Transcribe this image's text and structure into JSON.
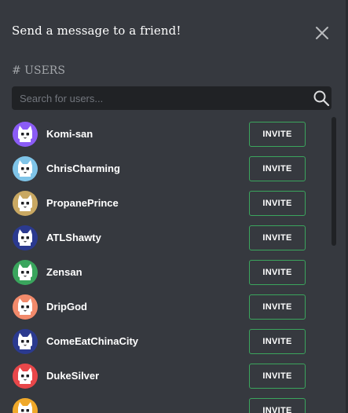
{
  "modal": {
    "title": "Send a message to a friend!",
    "section_label": "# USERS"
  },
  "search": {
    "placeholder": "Search for users...",
    "value": ""
  },
  "users": [
    {
      "name": "Komi-san",
      "avatar_color": "#8b5cf6",
      "invite_label": "INVITE"
    },
    {
      "name": "ChrisCharming",
      "avatar_color": "#7fc4e8",
      "invite_label": "INVITE"
    },
    {
      "name": "PropanePrince",
      "avatar_color": "#c9a862",
      "invite_label": "INVITE"
    },
    {
      "name": "ATLShawty",
      "avatar_color": "#2b3a8f",
      "invite_label": "INVITE"
    },
    {
      "name": "Zensan",
      "avatar_color": "#3aa55d",
      "invite_label": "INVITE"
    },
    {
      "name": "DripGod",
      "avatar_color": "#f28a6b",
      "invite_label": "INVITE"
    },
    {
      "name": "ComeEatChinaCity",
      "avatar_color": "#2b3a8f",
      "invite_label": "INVITE"
    },
    {
      "name": "DukeSilver",
      "avatar_color": "#e8474a",
      "invite_label": "INVITE"
    },
    {
      "name": "",
      "avatar_color": "#f0a92a",
      "invite_label": "INVITE"
    }
  ],
  "colors": {
    "accent_border": "#3ba55d",
    "background": "#36393f",
    "input_background": "#202225"
  },
  "icons": {
    "close": "close-icon",
    "search": "search-icon",
    "avatar": "cat-avatar-icon"
  }
}
